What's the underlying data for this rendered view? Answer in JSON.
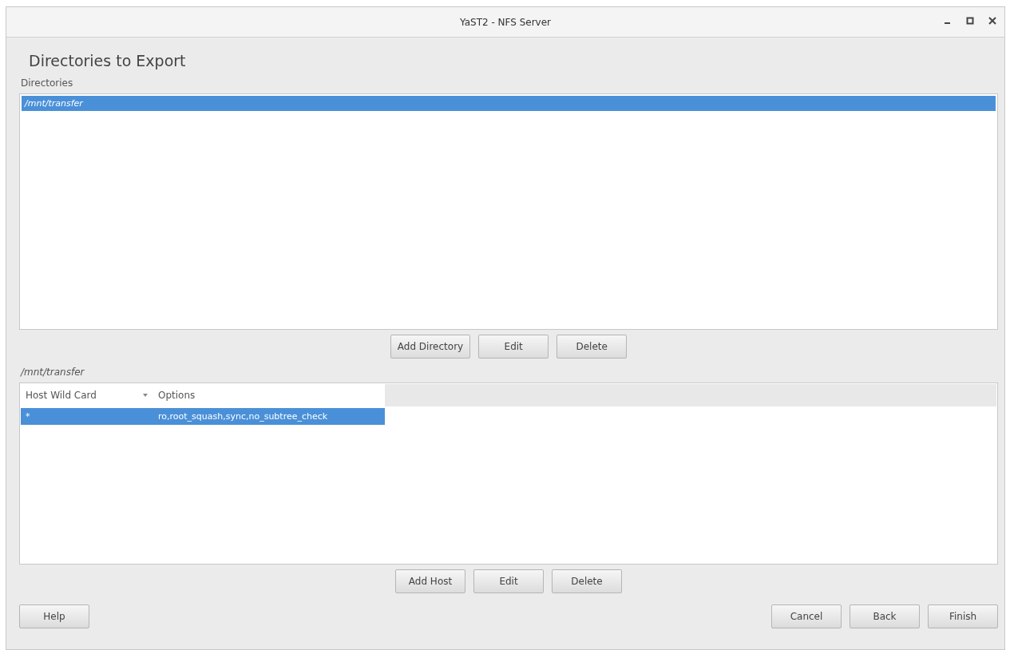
{
  "window": {
    "title": "YaST2 - NFS Server"
  },
  "heading": "Directories to Export",
  "directories": {
    "label": "Directories",
    "items": [
      {
        "path": "/mnt/transfer",
        "selected": true
      }
    ],
    "buttons": [
      "Add Directory",
      "Edit",
      "Delete"
    ]
  },
  "hosts": {
    "label": "/mnt/transfer",
    "columns": [
      {
        "label": "Host Wild Card",
        "sorted": true
      },
      {
        "label": "Options",
        "sorted": false
      }
    ],
    "rows": [
      {
        "cells": [
          "*",
          "ro,root_squash,sync,no_subtree_check"
        ],
        "selected": true
      }
    ],
    "buttons": [
      "Add Host",
      "Edit",
      "Delete"
    ]
  },
  "footer": {
    "left": [
      "Help"
    ],
    "right": [
      "Cancel",
      "Back",
      "Finish"
    ]
  }
}
